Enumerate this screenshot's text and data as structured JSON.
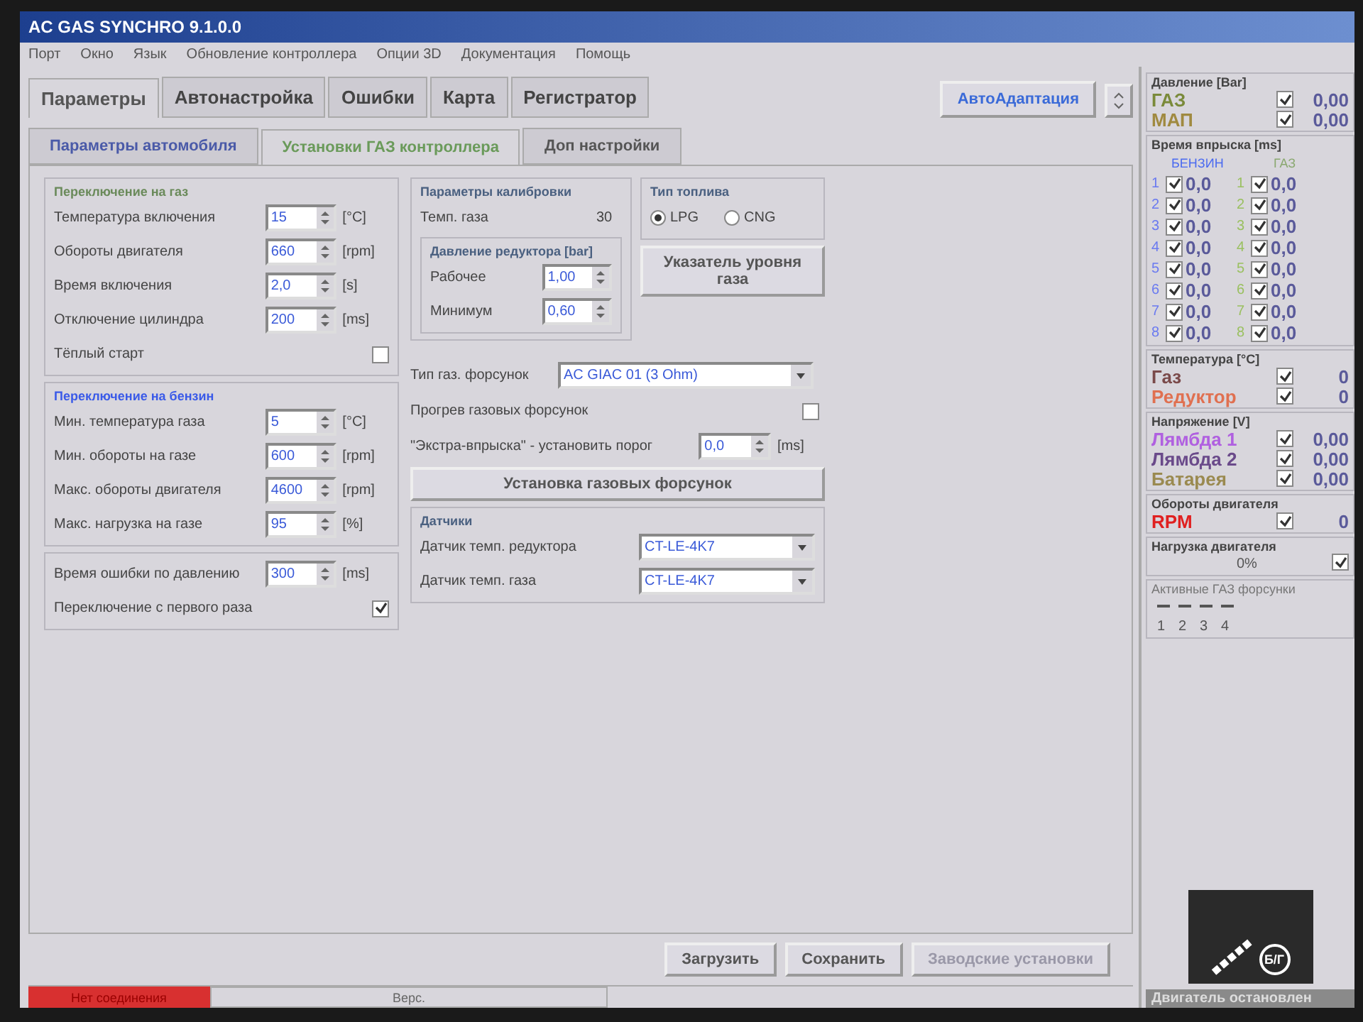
{
  "window": {
    "title": "AC GAS SYNCHRO 9.1.0.0"
  },
  "menu": [
    "Порт",
    "Окно",
    "Язык",
    "Обновление контроллера",
    "Опции 3D",
    "Документация",
    "Помощь"
  ],
  "main_tabs": [
    {
      "label": "Параметры",
      "selected": true
    },
    {
      "label": "Автонастройка",
      "selected": false
    },
    {
      "label": "Ошибки",
      "selected": false
    },
    {
      "label": "Карта",
      "selected": false
    },
    {
      "label": "Регистратор",
      "selected": false
    }
  ],
  "auto_button": "АвтоАдаптация",
  "sub_tabs": [
    {
      "label": "Параметры автомобиля",
      "selected": false
    },
    {
      "label": "Установки ГАЗ контроллера",
      "selected": true
    },
    {
      "label": "Доп настройки",
      "selected": false
    }
  ],
  "gas_switch": {
    "title": "Переключение на газ",
    "fields": [
      {
        "label": "Температура включения",
        "value": "15",
        "unit": "[°C]"
      },
      {
        "label": "Обороты двигателя",
        "value": "660",
        "unit": "[rpm]"
      },
      {
        "label": "Время включения",
        "value": "2,0",
        "unit": "[s]"
      },
      {
        "label": "Отключение цилиндра",
        "value": "200",
        "unit": "[ms]"
      }
    ],
    "warm_start": {
      "label": "Тёплый старт",
      "checked": false
    }
  },
  "petrol_switch": {
    "title": "Переключение на бензин",
    "fields": [
      {
        "label": "Мин. температура газа",
        "value": "5",
        "unit": "[°C]"
      },
      {
        "label": "Мин. обороты на газе",
        "value": "600",
        "unit": "[rpm]"
      },
      {
        "label": "Макс. обороты двигателя",
        "value": "4600",
        "unit": "[rpm]"
      },
      {
        "label": "Макс. нагрузка на газе",
        "value": "95",
        "unit": "[%]"
      }
    ]
  },
  "pressure_error": {
    "label": "Время ошибки по давлению",
    "value": "300",
    "unit": "[ms]"
  },
  "first_switch": {
    "label": "Переключение с первого раза",
    "checked": true
  },
  "calibration": {
    "title": "Параметры калибровки",
    "gas_temp_label": "Темп. газа",
    "gas_temp_value": "30",
    "reducer_title": "Давление редуктора [bar]",
    "fields": [
      {
        "label": "Рабочее",
        "value": "1,00"
      },
      {
        "label": "Минимум",
        "value": "0,60"
      }
    ]
  },
  "fuel_type": {
    "title": "Тип топлива",
    "options": [
      {
        "label": "LPG",
        "selected": true
      },
      {
        "label": "CNG",
        "selected": false
      }
    ]
  },
  "gas_level_button": "Указатель уровня газа",
  "injector_type": {
    "label": "Тип газ. форсунок",
    "value": "AC GIAC 01 (3 Ohm)"
  },
  "injector_heating": {
    "label": "Прогрев газовых форсунок",
    "checked": false
  },
  "extra_injection": {
    "label": "\"Экстра-впрыска\" - установить порог",
    "value": "0,0",
    "unit": "[ms]"
  },
  "injector_setup_button": "Установка газовых форсунок",
  "sensors": {
    "title": "Датчики",
    "fields": [
      {
        "label": "Датчик темп. редуктора",
        "value": "CT-LE-4K7"
      },
      {
        "label": "Датчик темп. газа",
        "value": "CT-LE-4K7"
      }
    ]
  },
  "bottom_buttons": [
    {
      "label": "Загрузить",
      "disabled": false
    },
    {
      "label": "Сохранить",
      "disabled": false
    },
    {
      "label": "Заводские установки",
      "disabled": true
    }
  ],
  "status_bar": {
    "connection": "Нет соединения",
    "version": "Верс."
  },
  "monitor": {
    "pressure": {
      "title": "Давление [Bar]",
      "rows": [
        {
          "name": "ГАЗ",
          "color": "#7a8a3a",
          "checked": true,
          "value": "0,00"
        },
        {
          "name": "МАП",
          "color": "#a08a40",
          "checked": true,
          "value": "0,00"
        }
      ]
    },
    "injection": {
      "title": "Время впрыска [ms]",
      "petrol_label": "БЕНЗИН",
      "gas_label": "ГАЗ",
      "rows": [
        {
          "petrol_num": "1",
          "petrol_checked": true,
          "petrol_value": "0,0",
          "gas_num": "1",
          "gas_checked": true,
          "gas_value": "0,0"
        },
        {
          "petrol_num": "2",
          "petrol_checked": true,
          "petrol_value": "0,0",
          "gas_num": "2",
          "gas_checked": true,
          "gas_value": "0,0"
        },
        {
          "petrol_num": "3",
          "petrol_checked": true,
          "petrol_value": "0,0",
          "gas_num": "3",
          "gas_checked": true,
          "gas_value": "0,0"
        },
        {
          "petrol_num": "4",
          "petrol_checked": true,
          "petrol_value": "0,0",
          "gas_num": "4",
          "gas_checked": true,
          "gas_value": "0,0"
        },
        {
          "petrol_num": "5",
          "petrol_checked": true,
          "petrol_value": "0,0",
          "gas_num": "5",
          "gas_checked": true,
          "gas_value": "0,0"
        },
        {
          "petrol_num": "6",
          "petrol_checked": true,
          "petrol_value": "0,0",
          "gas_num": "6",
          "gas_checked": true,
          "gas_value": "0,0"
        },
        {
          "petrol_num": "7",
          "petrol_checked": true,
          "petrol_value": "0,0",
          "gas_num": "7",
          "gas_checked": true,
          "gas_value": "0,0"
        },
        {
          "petrol_num": "8",
          "petrol_checked": true,
          "petrol_value": "0,0",
          "gas_num": "8",
          "gas_checked": true,
          "gas_value": "0,0"
        }
      ]
    },
    "temperature": {
      "title": "Температура [°C]",
      "rows": [
        {
          "name": "Газ",
          "color": "#7a4a4a",
          "checked": true,
          "value": "0"
        },
        {
          "name": "Редуктор",
          "color": "#e07050",
          "checked": true,
          "value": "0"
        }
      ]
    },
    "voltage": {
      "title": "Напряжение [V]",
      "rows": [
        {
          "name": "Лямбда 1",
          "color": "#b060e0",
          "checked": true,
          "value": "0,00"
        },
        {
          "name": "Лямбда 2",
          "color": "#6a4a8a",
          "checked": true,
          "value": "0,00"
        },
        {
          "name": "Батарея",
          "color": "#9a8a50",
          "checked": true,
          "value": "0,00"
        }
      ]
    },
    "rpm": {
      "title": "Обороты двигателя",
      "rows": [
        {
          "name": "RPM",
          "color": "#e02020",
          "checked": true,
          "value": "0"
        }
      ]
    },
    "load": {
      "title": "Нагрузка двигателя",
      "value": "0%",
      "checked": true
    },
    "active_injectors": {
      "title": "Активные ГАЗ форсунки",
      "items": [
        "1",
        "2",
        "3",
        "4"
      ]
    },
    "logo_text": "Б/Г",
    "engine_status": "Двигатель остановлен"
  }
}
